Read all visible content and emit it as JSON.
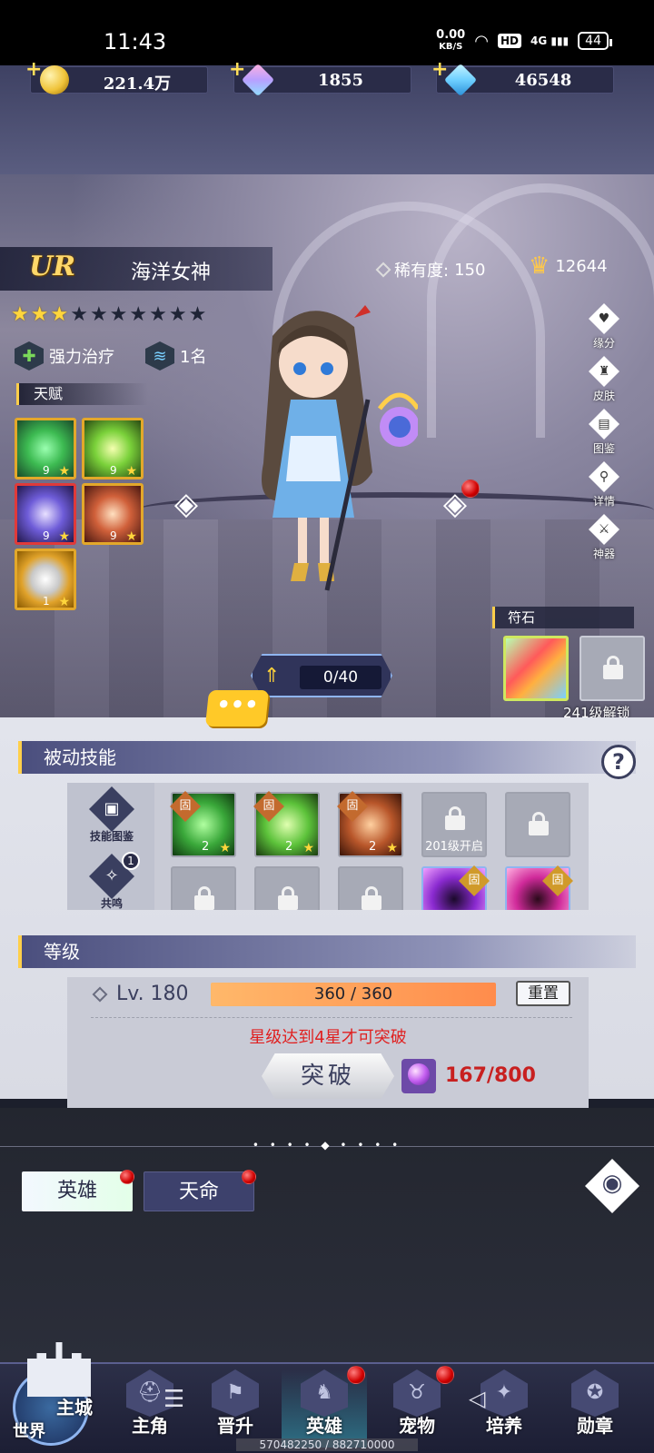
{
  "status_bar": {
    "time": "11:43",
    "net_speed": "0.00",
    "net_unit": "KB/S",
    "hd": "HD",
    "signal": "4G",
    "battery": "44"
  },
  "currencies": [
    {
      "name": "gold",
      "value": "221.4万",
      "color": "#f0c43a"
    },
    {
      "name": "rainbow-crystal",
      "value": "1855",
      "color": "#d8a0ff"
    },
    {
      "name": "diamond",
      "value": "46548",
      "color": "#6fd0ff"
    }
  ],
  "hero": {
    "rarity": "UR",
    "name": "海洋女神",
    "rarity_label": "稀有度:",
    "rarity_value": "150",
    "power": "12644",
    "stars_filled": 3,
    "stars_total": 10,
    "tags": [
      {
        "icon": "plus-icon",
        "label": "强力治疗"
      },
      {
        "icon": "wave-icon",
        "label": "1名"
      }
    ],
    "talent_title": "天赋",
    "talents": [
      {
        "level": "9",
        "color": "#3dbb52"
      },
      {
        "level": "9",
        "color": "#7ad13a"
      },
      {
        "level": "9",
        "color": "#6e5cd8"
      },
      {
        "level": "9",
        "color": "#d0603a"
      },
      {
        "level": "1",
        "color": "#e0a22a"
      }
    ]
  },
  "side_buttons": [
    "缘分",
    "皮肤",
    "图鉴",
    "详情",
    "神器"
  ],
  "rune": {
    "title": "符石",
    "unlock_text": "241级解锁"
  },
  "exp": {
    "value": "0/40"
  },
  "chat_label": "•••",
  "passive": {
    "title": "被动技能",
    "help": "?",
    "book_label": "技能图鉴",
    "resonance_label": "共鸣",
    "resonance_count": "1",
    "badge_text": "固",
    "skills_row1": [
      {
        "type": "skill",
        "level": "2",
        "color": "#3aa83a"
      },
      {
        "type": "skill",
        "level": "2",
        "color": "#5cc23a"
      },
      {
        "type": "skill",
        "level": "2",
        "color": "#b8562a"
      },
      {
        "type": "locked",
        "text": "201级开启"
      },
      {
        "type": "locked",
        "text": ""
      }
    ],
    "skills_row2": [
      {
        "type": "locked"
      },
      {
        "type": "locked"
      },
      {
        "type": "locked"
      },
      {
        "type": "skill",
        "color": "#8a2ad0"
      },
      {
        "type": "skill",
        "color": "#d02a9a"
      }
    ]
  },
  "level": {
    "title": "等级",
    "level_text": "Lv. 180",
    "exp_text": "360 / 360",
    "reset_label": "重置",
    "warning": "星级达到4星才可突破",
    "break_label": "突破",
    "orb_count": "167/800"
  },
  "tabs": [
    {
      "label": "英雄",
      "active": true
    },
    {
      "label": "天命",
      "active": false
    }
  ],
  "bottom_nav": {
    "world_label": "世界",
    "city_label": "主城",
    "items": [
      {
        "label": "主角",
        "icon": "helmet-icon"
      },
      {
        "label": "晋升",
        "icon": "banner-icon"
      },
      {
        "label": "英雄",
        "icon": "knight-icon",
        "active": true
      },
      {
        "label": "宠物",
        "icon": "beast-icon"
      },
      {
        "label": "培养",
        "icon": "emblem-icon"
      },
      {
        "label": "勋章",
        "icon": "medal-icon"
      }
    ],
    "footer_text": "570482250 / 882710000"
  }
}
